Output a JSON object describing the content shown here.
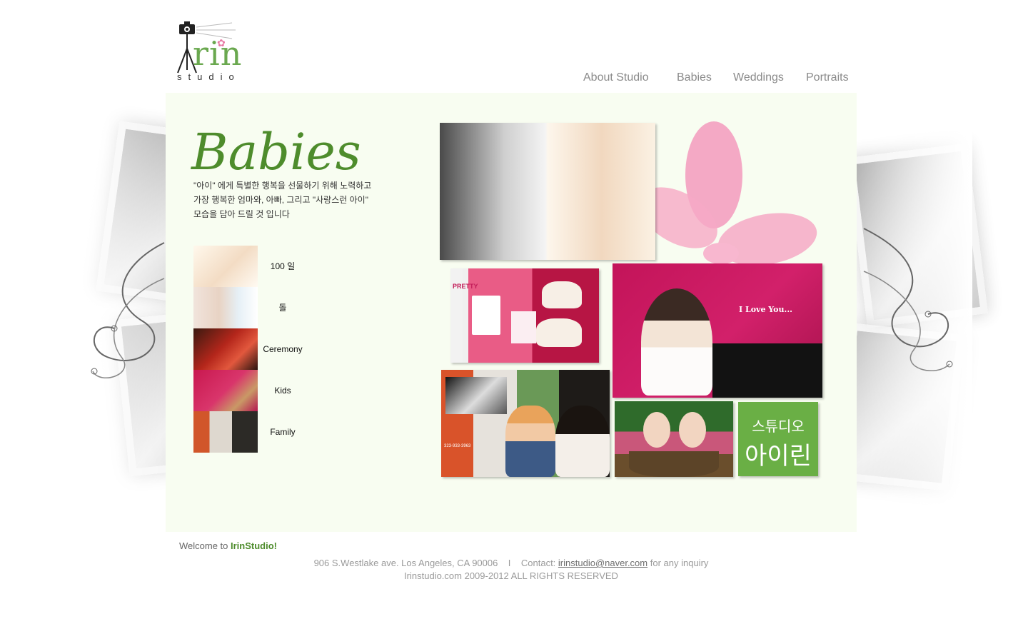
{
  "logo": {
    "text": "rin",
    "sub": "studio"
  },
  "nav": [
    {
      "label": "About Studio"
    },
    {
      "label": "Babies"
    },
    {
      "label": "Weddings"
    },
    {
      "label": "Portraits"
    }
  ],
  "page_title": "Babies",
  "intro_lines": [
    "\"아이\" 에게 특별한 행복을 선물하기 위해 노력하고",
    "가장 행복한 엄마와, 아빠, 그리고 \"사랑스런 아이\"",
    "모습을 담아 드릴 것 입니다"
  ],
  "categories": [
    {
      "label": "100 일"
    },
    {
      "label": "돌"
    },
    {
      "label": "Ceremony"
    },
    {
      "label": "Kids"
    },
    {
      "label": "Family"
    }
  ],
  "collage": {
    "pretty_text": "PRETTY",
    "love_text": "I Love You...",
    "green_tile": {
      "line1": "스튜디오",
      "line2": "아이린"
    },
    "phone": "323-933-3963"
  },
  "colors": {
    "accent": "#4e8c2c",
    "panel_bg": "#f8fdf1",
    "pink": "#e0467c"
  },
  "footer": {
    "welcome_prefix": "Welcome to ",
    "welcome_brand": "IrinStudio!",
    "address": "906 S.Westlake ave. Los Angeles, CA 90006",
    "separator": "I",
    "contact_prefix": "Contact:",
    "email": "irinstudio@naver.com",
    "contact_suffix": "for any inquiry",
    "copyright": "Irinstudio.com 2009-2012 ALL RIGHTS RESERVED"
  }
}
